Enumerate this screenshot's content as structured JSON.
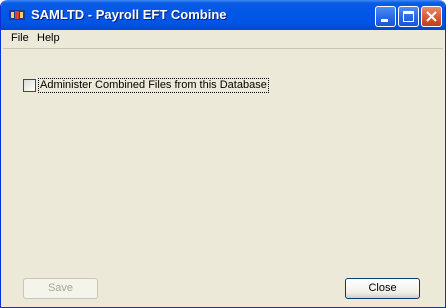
{
  "window": {
    "title": "SAMLTD - Payroll EFT Combine"
  },
  "menu": {
    "file": "File",
    "help": "Help"
  },
  "options": {
    "administer_label": "Administer Combined Files from this Database",
    "administer_checked": false
  },
  "buttons": {
    "save": "Save",
    "close": "Close"
  }
}
